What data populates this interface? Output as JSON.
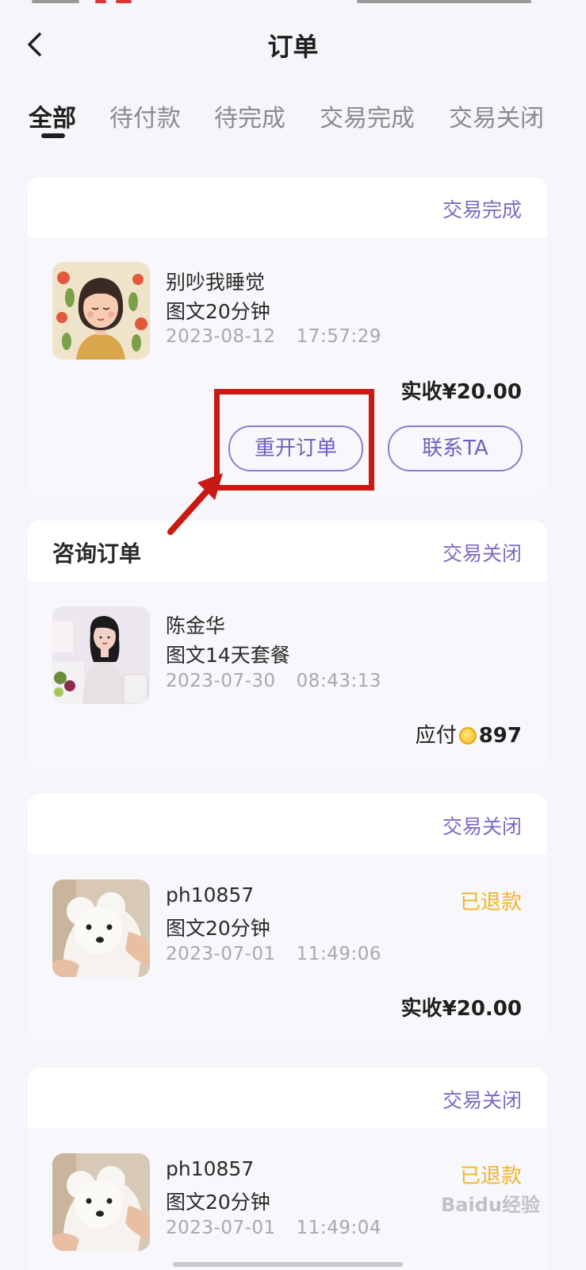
{
  "header": {
    "title": "订单"
  },
  "tabs": [
    {
      "label": "全部"
    },
    {
      "label": "待付款"
    },
    {
      "label": "待完成"
    },
    {
      "label": "交易完成"
    },
    {
      "label": "交易关闭"
    }
  ],
  "orders": [
    {
      "type": "",
      "status": "交易完成",
      "name": "别吵我睡觉",
      "item": "图文20分钟",
      "date": "2023-08-12",
      "time": "17:57:29",
      "amount": "实收¥20.00",
      "actions": [
        {
          "label": "重开订单"
        },
        {
          "label": "联系TA"
        }
      ]
    },
    {
      "type": "咨询订单",
      "status": "交易关闭",
      "name": "陈金华",
      "item": "图文14天套餐",
      "date": "2023-07-30",
      "time": "08:43:13",
      "amount_label": "应付",
      "amount_value": "897"
    },
    {
      "type": "",
      "status": "交易关闭",
      "name": "ph10857",
      "item": "图文20分钟",
      "date": "2023-07-01",
      "time": "11:49:06",
      "refund": "已退款",
      "amount": "实收¥20.00"
    },
    {
      "type": "",
      "status": "交易关闭",
      "name": "ph10857",
      "item": "图文20分钟",
      "date": "2023-07-01",
      "time": "11:49:04",
      "refund": "已退款"
    }
  ],
  "watermark": "Baidu经验",
  "colors": {
    "accent": "#7b6cc4",
    "refund": "#f0b429",
    "annotation": "#c81a12"
  }
}
